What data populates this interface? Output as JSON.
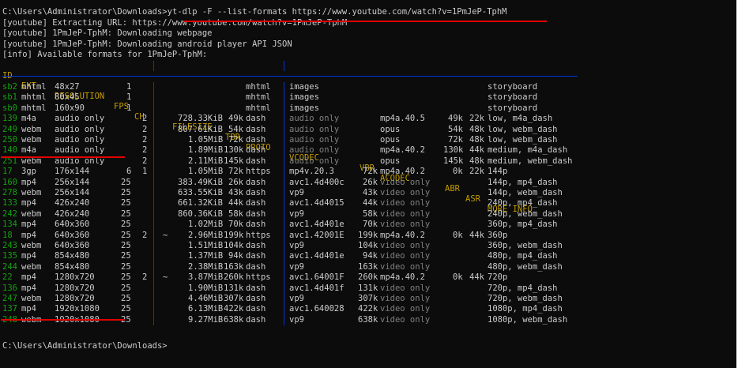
{
  "terminal": {
    "prompt": "C:\\Users\\Administrator\\Downloads>",
    "command": "yt-dlp -F --list-formats https://www.youtube.com/watch?v=1PmJeP-TphM",
    "log": [
      "[youtube] Extracting URL: https://www.youtube.com/watch?v=1PmJeP-TphM",
      "[youtube] 1PmJeP-TphM: Downloading webpage",
      "[youtube] 1PmJeP-TphM: Downloading android player API JSON",
      "[info] Available formats for 1PmJeP-TphM:"
    ],
    "header": {
      "id": "ID",
      "ext": "EXT",
      "resolution": "RESOLUTION",
      "fps": "FPS",
      "ch": "CH",
      "filesize": "FILESIZE",
      "tbr": "TBR",
      "proto": "PROTO",
      "vcodec": "VCODEC",
      "vbr": "VBR",
      "acodec": "ACODEC",
      "abr": "ABR",
      "asr": "ASR",
      "more_info": "MORE INFO"
    },
    "formats": [
      {
        "id": "sb2",
        "ext": "mhtml",
        "res": "48x27",
        "fps": "1",
        "ch": "",
        "approx": "",
        "size": "",
        "tbr": "",
        "proto": "mhtml",
        "vcodec": "images",
        "vdim": false,
        "vbr": "",
        "acodec": "",
        "adim": false,
        "abr": "",
        "asr": "",
        "info": "storyboard"
      },
      {
        "id": "sb1",
        "ext": "mhtml",
        "res": "80x45",
        "fps": "1",
        "ch": "",
        "approx": "",
        "size": "",
        "tbr": "",
        "proto": "mhtml",
        "vcodec": "images",
        "vdim": false,
        "vbr": "",
        "acodec": "",
        "adim": false,
        "abr": "",
        "asr": "",
        "info": "storyboard"
      },
      {
        "id": "sb0",
        "ext": "mhtml",
        "res": "160x90",
        "fps": "1",
        "ch": "",
        "approx": "",
        "size": "",
        "tbr": "",
        "proto": "mhtml",
        "vcodec": "images",
        "vdim": false,
        "vbr": "",
        "acodec": "",
        "adim": false,
        "abr": "",
        "asr": "",
        "info": "storyboard"
      },
      {
        "id": "139",
        "ext": "m4a",
        "res": "audio only",
        "fps": "",
        "ch": "2",
        "approx": "",
        "size": "728.33KiB",
        "tbr": "49k",
        "proto": "dash",
        "vcodec": "audio only",
        "vdim": true,
        "vbr": "",
        "acodec": "mp4a.40.5",
        "adim": false,
        "abr": "49k",
        "asr": "22k",
        "info": "low, m4a_dash"
      },
      {
        "id": "249",
        "ext": "webm",
        "res": "audio only",
        "fps": "",
        "ch": "2",
        "approx": "",
        "size": "807.61KiB",
        "tbr": "54k",
        "proto": "dash",
        "vcodec": "audio only",
        "vdim": true,
        "vbr": "",
        "acodec": "opus",
        "adim": false,
        "abr": "54k",
        "asr": "48k",
        "info": "low, webm_dash"
      },
      {
        "id": "250",
        "ext": "webm",
        "res": "audio only",
        "fps": "",
        "ch": "2",
        "approx": "",
        "size": "1.05MiB",
        "tbr": "72k",
        "proto": "dash",
        "vcodec": "audio only",
        "vdim": true,
        "vbr": "",
        "acodec": "opus",
        "adim": false,
        "abr": "72k",
        "asr": "48k",
        "info": "low, webm_dash"
      },
      {
        "id": "140",
        "ext": "m4a",
        "res": "audio only",
        "fps": "",
        "ch": "2",
        "approx": "",
        "size": "1.89MiB",
        "tbr": "130k",
        "proto": "dash",
        "vcodec": "audio only",
        "vdim": true,
        "vbr": "",
        "acodec": "mp4a.40.2",
        "adim": false,
        "abr": "130k",
        "asr": "44k",
        "info": "medium, m4a_dash"
      },
      {
        "id": "251",
        "ext": "webm",
        "res": "audio only",
        "fps": "",
        "ch": "2",
        "approx": "",
        "size": "2.11MiB",
        "tbr": "145k",
        "proto": "dash",
        "vcodec": "audio only",
        "vdim": true,
        "vbr": "",
        "acodec": "opus",
        "adim": false,
        "abr": "145k",
        "asr": "48k",
        "info": "medium, webm_dash"
      },
      {
        "id": "17",
        "ext": "3gp",
        "res": "176x144",
        "fps": "6",
        "ch": "1",
        "approx": "",
        "size": "1.05MiB",
        "tbr": "72k",
        "proto": "https",
        "vcodec": "mp4v.20.3",
        "vdim": false,
        "vbr": "72k",
        "acodec": "mp4a.40.2",
        "adim": false,
        "abr": "0k",
        "asr": "22k",
        "info": "144p"
      },
      {
        "id": "160",
        "ext": "mp4",
        "res": "256x144",
        "fps": "25",
        "ch": "",
        "approx": "",
        "size": "383.49KiB",
        "tbr": "26k",
        "proto": "dash",
        "vcodec": "avc1.4d400c",
        "vdim": false,
        "vbr": "26k",
        "acodec": "video only",
        "adim": true,
        "abr": "",
        "asr": "",
        "info": "144p, mp4_dash"
      },
      {
        "id": "278",
        "ext": "webm",
        "res": "256x144",
        "fps": "25",
        "ch": "",
        "approx": "",
        "size": "633.55KiB",
        "tbr": "43k",
        "proto": "dash",
        "vcodec": "vp9",
        "vdim": false,
        "vbr": "43k",
        "acodec": "video only",
        "adim": true,
        "abr": "",
        "asr": "",
        "info": "144p, webm_dash"
      },
      {
        "id": "133",
        "ext": "mp4",
        "res": "426x240",
        "fps": "25",
        "ch": "",
        "approx": "",
        "size": "661.32KiB",
        "tbr": "44k",
        "proto": "dash",
        "vcodec": "avc1.4d4015",
        "vdim": false,
        "vbr": "44k",
        "acodec": "video only",
        "adim": true,
        "abr": "",
        "asr": "",
        "info": "240p, mp4_dash"
      },
      {
        "id": "242",
        "ext": "webm",
        "res": "426x240",
        "fps": "25",
        "ch": "",
        "approx": "",
        "size": "860.36KiB",
        "tbr": "58k",
        "proto": "dash",
        "vcodec": "vp9",
        "vdim": false,
        "vbr": "58k",
        "acodec": "video only",
        "adim": true,
        "abr": "",
        "asr": "",
        "info": "240p, webm_dash"
      },
      {
        "id": "134",
        "ext": "mp4",
        "res": "640x360",
        "fps": "25",
        "ch": "",
        "approx": "",
        "size": "1.02MiB",
        "tbr": "70k",
        "proto": "dash",
        "vcodec": "avc1.4d401e",
        "vdim": false,
        "vbr": "70k",
        "acodec": "video only",
        "adim": true,
        "abr": "",
        "asr": "",
        "info": "360p, mp4_dash"
      },
      {
        "id": "18",
        "ext": "mp4",
        "res": "640x360",
        "fps": "25",
        "ch": "2",
        "approx": "~",
        "size": "2.96MiB",
        "tbr": "199k",
        "proto": "https",
        "vcodec": "avc1.42001E",
        "vdim": false,
        "vbr": "199k",
        "acodec": "mp4a.40.2",
        "adim": false,
        "abr": "0k",
        "asr": "44k",
        "info": "360p"
      },
      {
        "id": "243",
        "ext": "webm",
        "res": "640x360",
        "fps": "25",
        "ch": "",
        "approx": "",
        "size": "1.51MiB",
        "tbr": "104k",
        "proto": "dash",
        "vcodec": "vp9",
        "vdim": false,
        "vbr": "104k",
        "acodec": "video only",
        "adim": true,
        "abr": "",
        "asr": "",
        "info": "360p, webm_dash"
      },
      {
        "id": "135",
        "ext": "mp4",
        "res": "854x480",
        "fps": "25",
        "ch": "",
        "approx": "",
        "size": "1.37MiB",
        "tbr": "94k",
        "proto": "dash",
        "vcodec": "avc1.4d401e",
        "vdim": false,
        "vbr": "94k",
        "acodec": "video only",
        "adim": true,
        "abr": "",
        "asr": "",
        "info": "480p, mp4_dash"
      },
      {
        "id": "244",
        "ext": "webm",
        "res": "854x480",
        "fps": "25",
        "ch": "",
        "approx": "",
        "size": "2.38MiB",
        "tbr": "163k",
        "proto": "dash",
        "vcodec": "vp9",
        "vdim": false,
        "vbr": "163k",
        "acodec": "video only",
        "adim": true,
        "abr": "",
        "asr": "",
        "info": "480p, webm_dash"
      },
      {
        "id": "22",
        "ext": "mp4",
        "res": "1280x720",
        "fps": "25",
        "ch": "2",
        "approx": "~",
        "size": "3.87MiB",
        "tbr": "260k",
        "proto": "https",
        "vcodec": "avc1.64001F",
        "vdim": false,
        "vbr": "260k",
        "acodec": "mp4a.40.2",
        "adim": false,
        "abr": "0k",
        "asr": "44k",
        "info": "720p"
      },
      {
        "id": "136",
        "ext": "mp4",
        "res": "1280x720",
        "fps": "25",
        "ch": "",
        "approx": "",
        "size": "1.90MiB",
        "tbr": "131k",
        "proto": "dash",
        "vcodec": "avc1.4d401f",
        "vdim": false,
        "vbr": "131k",
        "acodec": "video only",
        "adim": true,
        "abr": "",
        "asr": "",
        "info": "720p, mp4_dash"
      },
      {
        "id": "247",
        "ext": "webm",
        "res": "1280x720",
        "fps": "25",
        "ch": "",
        "approx": "",
        "size": "4.46MiB",
        "tbr": "307k",
        "proto": "dash",
        "vcodec": "vp9",
        "vdim": false,
        "vbr": "307k",
        "acodec": "video only",
        "adim": true,
        "abr": "",
        "asr": "",
        "info": "720p, webm_dash"
      },
      {
        "id": "137",
        "ext": "mp4",
        "res": "1920x1080",
        "fps": "25",
        "ch": "",
        "approx": "",
        "size": "6.13MiB",
        "tbr": "422k",
        "proto": "dash",
        "vcodec": "avc1.640028",
        "vdim": false,
        "vbr": "422k",
        "acodec": "video only",
        "adim": true,
        "abr": "",
        "asr": "",
        "info": "1080p, mp4_dash"
      },
      {
        "id": "248",
        "ext": "webm",
        "res": "1920x1080",
        "fps": "25",
        "ch": "",
        "approx": "",
        "size": "9.27MiB",
        "tbr": "638k",
        "proto": "dash",
        "vcodec": "vp9",
        "vdim": false,
        "vbr": "638k",
        "acodec": "video only",
        "adim": true,
        "abr": "",
        "asr": "",
        "info": "1080p, webm_dash"
      }
    ],
    "final_prompt": "C:\\Users\\Administrator\\Downloads>"
  },
  "colors": {
    "background": "#0c0c0c",
    "text": "#cccccc",
    "id_green": "#13a10e",
    "dim_gray": "#808080",
    "header_yellow": "#c19c00",
    "separator_blue": "#0037da",
    "annotation_red": "#e00000"
  }
}
